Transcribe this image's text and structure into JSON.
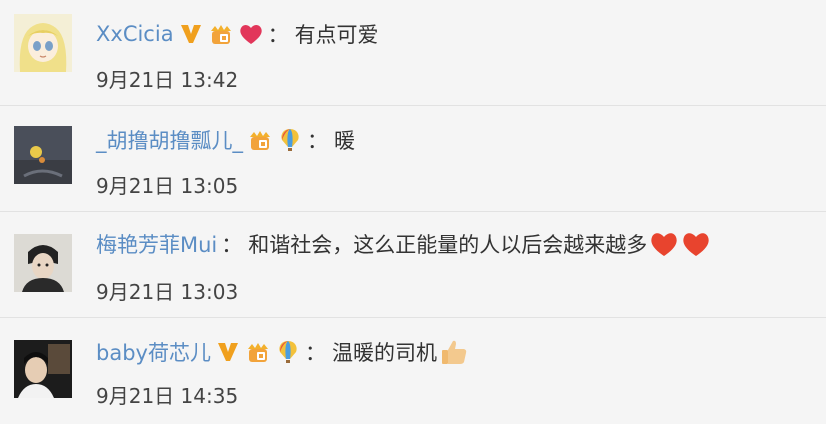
{
  "comments": [
    {
      "username": "XxCicia",
      "text": "有点可爱",
      "time": "9月21日 13:42",
      "badges": [
        "verified-v-icon",
        "crown-level-icon",
        "heart-icon"
      ],
      "trailing_emoji": []
    },
    {
      "username": "_胡撸胡撸瓢儿_",
      "text": "暖",
      "time": "9月21日 13:05",
      "badges": [
        "crown-level-icon",
        "balloon-icon"
      ],
      "trailing_emoji": []
    },
    {
      "username": "梅艳芳菲Mui",
      "text": "和谐社会，这么正能量的人以后会越来越多",
      "time": "9月21日 13:03",
      "badges": [],
      "trailing_emoji": [
        "heart-emoji",
        "heart-emoji"
      ]
    },
    {
      "username": "baby荷芯儿",
      "text": "温暖的司机",
      "time": "9月21日 14:35",
      "badges": [
        "verified-v-icon",
        "crown-level-icon",
        "balloon-icon"
      ],
      "trailing_emoji": [
        "thumbs-up-emoji"
      ]
    }
  ],
  "colon": "：",
  "colors": {
    "username": "#5b8dc4",
    "verified": "#f0a01e",
    "heart": "#e2365a",
    "background": "#f5f5f5"
  }
}
